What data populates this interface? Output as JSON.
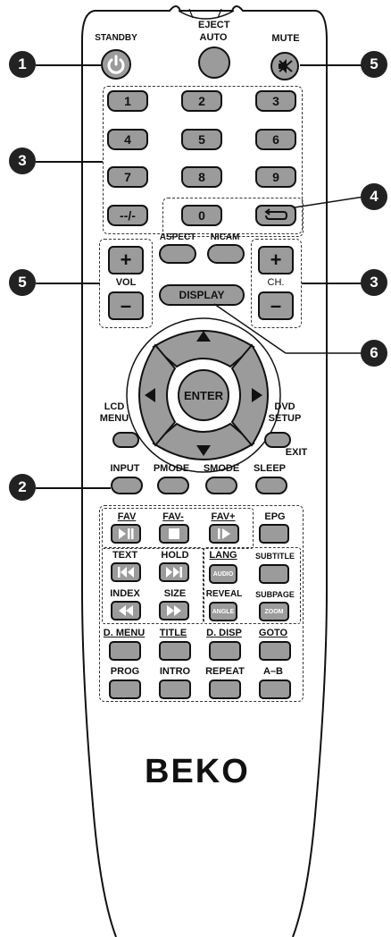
{
  "labels": {
    "standby": "STANDBY",
    "eject_auto_1": "EJECT",
    "eject_auto_2": "AUTO",
    "mute": "MUTE",
    "aspect": "ASPECT",
    "nicam": "NICAM",
    "vol": "VOL",
    "ch": "CH.",
    "display": "DISPLAY",
    "enter": "ENTER",
    "lcd_menu_1": "LCD",
    "lcd_menu_2": "MENU",
    "dvd_setup_1": "DVD",
    "dvd_setup_2": "SETUP",
    "exit": "EXIT",
    "input": "INPUT",
    "pmode": "PMODE",
    "smode": "SMODE",
    "sleep": "SLEEP",
    "fav": "FAV",
    "fav_minus": "FAV-",
    "fav_plus": "FAV+",
    "epg": "EPG",
    "text": "TEXT",
    "hold": "HOLD",
    "lang": "LANG",
    "subtitle": "SUBTITLE",
    "index": "INDEX",
    "size": "SIZE",
    "reveal": "REVEAL",
    "subpage": "SUBPAGE",
    "audio": "AUDIO",
    "angle": "ANGLE",
    "zoom": "ZOOM",
    "d_menu": "D. MENU",
    "title": "TITLE",
    "d_disp": "D. DISP",
    "goto": "GOTO",
    "prog": "PROG",
    "intro": "INTRO",
    "repeat": "REPEAT",
    "a_b": "A–B",
    "brand": "BEKO"
  },
  "keypad": [
    "1",
    "2",
    "3",
    "4",
    "5",
    "6",
    "7",
    "8",
    "9",
    "--/-",
    "0"
  ],
  "plus_sign": "+",
  "minus_sign": "–",
  "callouts": {
    "c1": "1",
    "c2": "2",
    "c3a": "3",
    "c3b": "3",
    "c4": "4",
    "c5a": "5",
    "c5b": "5",
    "c6": "6"
  }
}
